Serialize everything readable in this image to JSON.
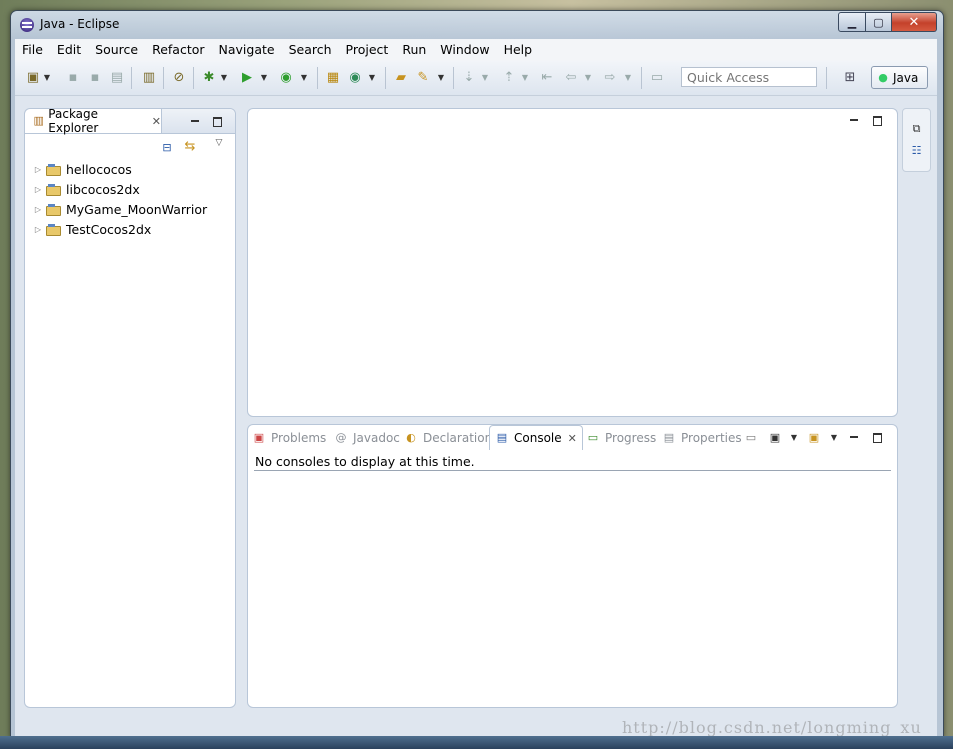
{
  "window": {
    "title": "Java - Eclipse",
    "buttons": {
      "minimize": "▁",
      "maximize": "▢",
      "close": "✕"
    }
  },
  "menubar": [
    "File",
    "Edit",
    "Source",
    "Refactor",
    "Navigate",
    "Search",
    "Project",
    "Run",
    "Window",
    "Help"
  ],
  "toolbar": {
    "quick_access_placeholder": "Quick Access",
    "perspective_label": "Java"
  },
  "package_explorer": {
    "tab_label": "Package Explorer",
    "projects": [
      "hellococos",
      "libcocos2dx",
      "MyGame_MoonWarrior",
      "TestCocos2dx"
    ]
  },
  "bottom_panel": {
    "tabs": [
      {
        "label": "Problems",
        "icon": "problems-icon"
      },
      {
        "label": "Javadoc",
        "icon": "javadoc-icon"
      },
      {
        "label": "Declaration",
        "icon": "declaration-icon"
      },
      {
        "label": "Console",
        "icon": "console-icon",
        "active": true
      },
      {
        "label": "Progress",
        "icon": "progress-icon"
      },
      {
        "label": "Properties",
        "icon": "properties-icon"
      }
    ],
    "console_message": "No consoles to display at this time."
  },
  "watermark": "http://blog.csdn.net/longming_xu"
}
